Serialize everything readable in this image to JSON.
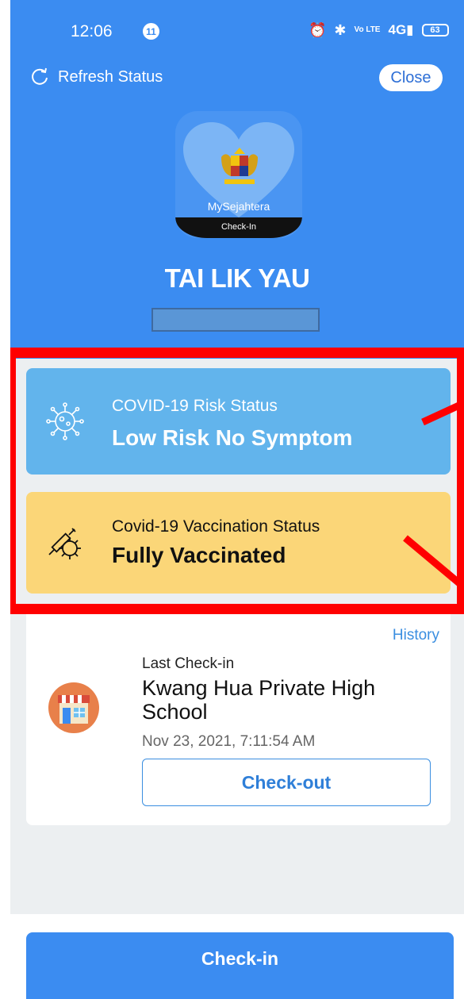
{
  "status_bar": {
    "time": "12:06",
    "notification_count": "11",
    "volte": "Vo LTE",
    "network": "4G",
    "battery": "63"
  },
  "header": {
    "refresh_label": "Refresh Status",
    "close_label": "Close"
  },
  "logo": {
    "app_name": "MySejahtera",
    "strip_label": "Check-In"
  },
  "user": {
    "name": "TAI LIK YAU"
  },
  "risk_status": {
    "label": "COVID-19 Risk Status",
    "value": "Low Risk No Symptom",
    "color": "#62b4ec"
  },
  "vaccination_status": {
    "label": "Covid-19 Vaccination Status",
    "value": "Fully Vaccinated",
    "color": "#fbd678"
  },
  "checkin": {
    "history_label": "History",
    "last_label": "Last Check-in",
    "place": "Kwang Hua Private High School",
    "timestamp": "Nov 23, 2021, 7:11:54 AM",
    "checkout_label": "Check-out"
  },
  "footer": {
    "checkin_label": "Check-in"
  },
  "colors": {
    "primary": "#3b8cf1",
    "highlight": "#ff0000"
  }
}
